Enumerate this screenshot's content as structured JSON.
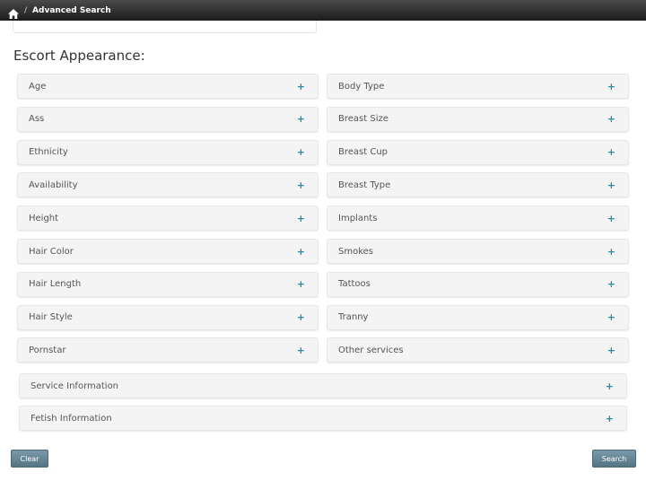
{
  "header": {
    "breadcrumb_sep": "/",
    "breadcrumb_current": "Advanced Search"
  },
  "section": {
    "title": "Escort Appearance:"
  },
  "left_items": [
    {
      "label": "Age"
    },
    {
      "label": "Ass"
    },
    {
      "label": "Ethnicity"
    },
    {
      "label": "Availability"
    },
    {
      "label": "Height"
    },
    {
      "label": "Hair Color"
    },
    {
      "label": "Hair Length"
    },
    {
      "label": "Hair Style"
    },
    {
      "label": "Pornstar"
    }
  ],
  "right_items": [
    {
      "label": "Body Type"
    },
    {
      "label": "Breast Size"
    },
    {
      "label": "Breast Cup"
    },
    {
      "label": "Breast Type"
    },
    {
      "label": "Implants"
    },
    {
      "label": "Smokes"
    },
    {
      "label": "Tattoos"
    },
    {
      "label": "Tranny"
    },
    {
      "label": "Other services"
    }
  ],
  "wide_items": [
    {
      "label": "Service Information"
    },
    {
      "label": "Fetish Information"
    }
  ],
  "expand_glyph": "+",
  "buttons": {
    "clear": "Clear",
    "search": "Search"
  },
  "colors": {
    "accent": "#2a8fa3",
    "button": "#5f7f8f"
  }
}
